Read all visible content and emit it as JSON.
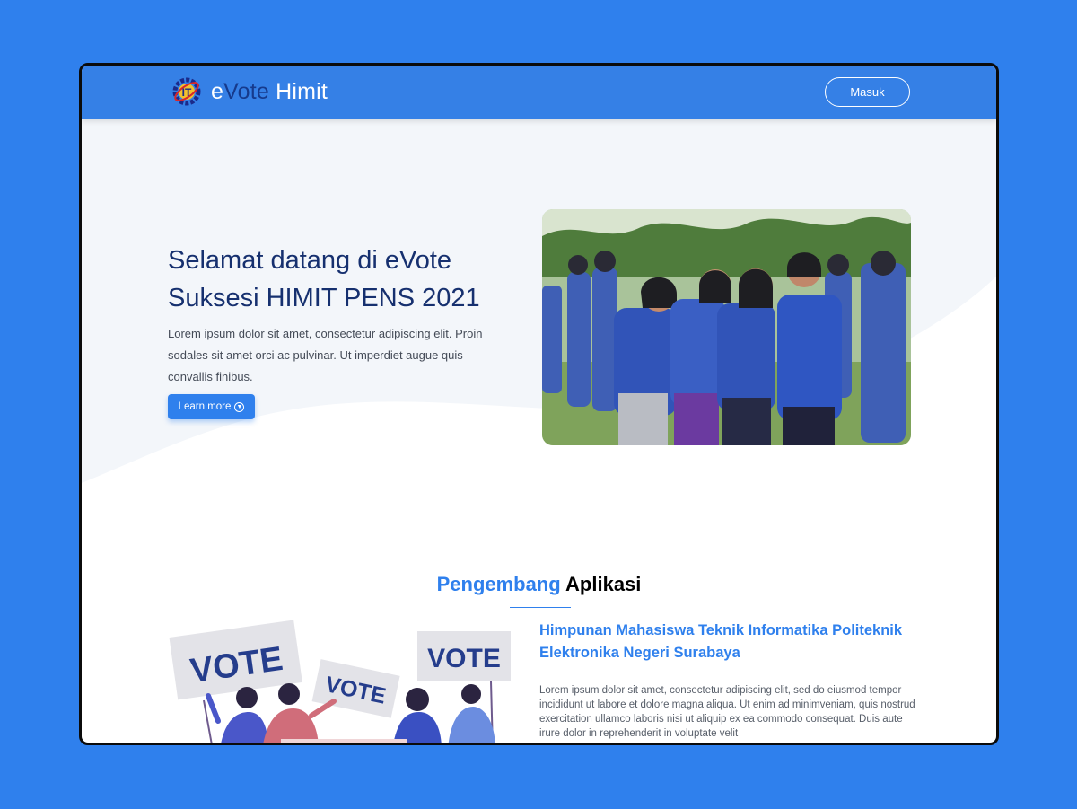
{
  "navbar": {
    "brand_prefix": "e",
    "brand_accent": "Vote",
    "brand_suffix": " Himit",
    "login_label": "Masuk"
  },
  "hero": {
    "title": "Selamat datang di eVote Suksesi HIMIT PENS 2021",
    "description": "Lorem ipsum dolor sit amet, consectetur adipiscing elit. Proin sodales sit amet orci ac pulvinar. Ut imperdiet augue quis convallis finibus.",
    "button_label": "Learn more",
    "button_icon": "arrow-down-circle-icon"
  },
  "developer": {
    "title_accent": "Pengembang",
    "title_rest": "Aplikasi",
    "org_name": "Himpunan Mahasiswa Teknik Informatika Politeknik Elektronika Negeri Surabaya",
    "description": "Lorem ipsum dolor sit amet, consectetur adipiscing elit, sed do eiusmod tempor incididunt ut labore et dolore magna aliqua. Ut enim ad minimveniam, quis nostrud exercitation ullamco laboris nisi ut aliquip ex ea commodo consequat. Duis aute irure dolor in reprehenderit in voluptate velit",
    "illustration_signs": [
      "VOTE",
      "VOTE",
      "VOTE"
    ]
  },
  "colors": {
    "background": "#2f80ed",
    "navbar": "#3580e6",
    "title": "#16306f",
    "accent": "#2f80ed"
  }
}
